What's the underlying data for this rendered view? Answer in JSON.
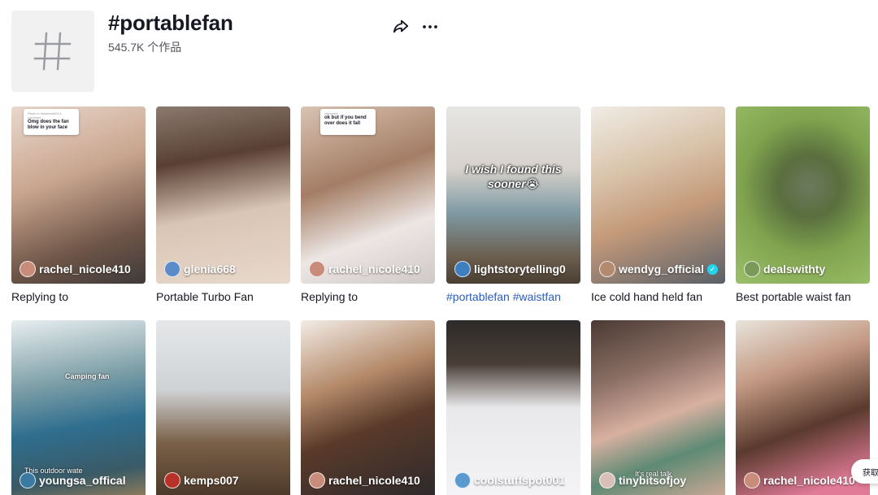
{
  "header": {
    "title": "#portablefan",
    "count": "545.7K 个作品",
    "share_icon": "share-icon",
    "more_icon": "more-icon"
  },
  "videos": [
    {
      "user": "rachel_nicole410",
      "caption": "Replying to",
      "bubble_meta": "Reply to Nailawoke01's comment",
      "bubble_text": "Omg does the fan blow in your face",
      "bg": "#6b5a4e"
    },
    {
      "user": "glenia668",
      "caption": "Portable Turbo Fan",
      "bg": "#b9a394"
    },
    {
      "user": "rachel_nicole410",
      "caption": "Replying to",
      "bubble_meta": "comment",
      "bubble_text": "ok but if you bend over does it fall",
      "bg": "#8a7668"
    },
    {
      "user": "lightstorytelling0",
      "caption": "#portablefan #waistfan",
      "overlay": "I wish I found this sooner😭",
      "bg": "#c9c6c0"
    },
    {
      "user": "wendyg_official",
      "verified": true,
      "caption": "Ice cold hand held fan",
      "bg": "#9a8a7d"
    },
    {
      "user": "dealswithty",
      "caption": "Best portable waist fan",
      "bg": "#6f8c4a"
    },
    {
      "user": "youngsa_offical",
      "overlay_small": "This outdoor wate",
      "box_label": "Camping fan",
      "bg": "#8aa4a8"
    },
    {
      "user": "kemps007",
      "bg": "#5a4a3c"
    },
    {
      "user": "rachel_nicole410",
      "bg": "#6a5043"
    },
    {
      "user": "coolstuffspot001",
      "bg": "#3a3c40"
    },
    {
      "user": "tinybitsofjoy",
      "overlay_small": "It's real talk",
      "bg": "#9c8a86"
    },
    {
      "user": "rachel_nicole410",
      "bg": "#7a5e52"
    }
  ],
  "floating_button": "获取"
}
